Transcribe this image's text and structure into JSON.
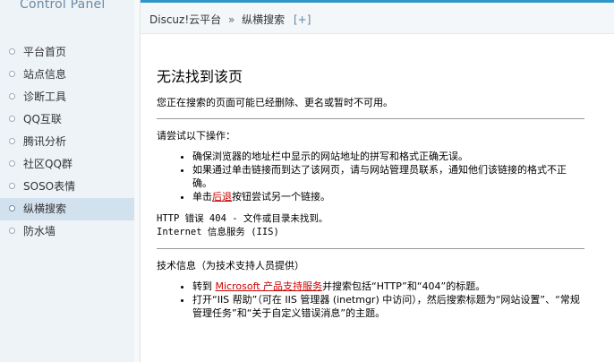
{
  "brand": "Control Panel",
  "nav": [
    {
      "label": "平台首页"
    },
    {
      "label": "站点信息"
    },
    {
      "label": "诊断工具"
    },
    {
      "label": "QQ互联"
    },
    {
      "label": "腾讯分析"
    },
    {
      "label": "社区QQ群"
    },
    {
      "label": "SOSO表情"
    },
    {
      "label": "纵横搜索",
      "active": true
    },
    {
      "label": "防水墙"
    }
  ],
  "breadcrumb": {
    "root": "Discuz!云平台",
    "separator": "»",
    "current": "纵横搜索",
    "add": "[+]"
  },
  "error": {
    "title": "无法找到该页",
    "description": "您正在搜索的页面可能已经删除、更名或暂时不可用。",
    "try_heading": "请尝试以下操作：",
    "tips": [
      "确保浏览器的地址栏中显示的网站地址的拼写和格式正确无误。",
      "如果通过单击链接而到达了该网页，请与网站管理员联系，通知他们该链接的格式不正确。"
    ],
    "tip_back_prefix": "单击",
    "tip_back_link": "后退",
    "tip_back_suffix": "按钮尝试另一个链接。",
    "http_line": "HTTP 错误 404 - 文件或目录未找到。",
    "iis_line": "Internet 信息服务 (IIS)",
    "tech_heading": "技术信息（为技术支持人员提供）",
    "tech_goto_prefix": "转到 ",
    "tech_goto_link": "Microsoft 产品支持服务",
    "tech_goto_suffix": "并搜索包括“HTTP”和“404”的标题。",
    "tech_help": "打开“IIS 帮助”（可在 IIS 管理器 (inetmgr) 中访问），然后搜索标题为“网站设置”、“常规管理任务”和“关于自定义错误消息”的主题。"
  },
  "colors": {
    "accent": "#2f94c8",
    "sidebar_bg": "#eef3f7",
    "active_bg": "#d2e1ee",
    "link": "#cc0000"
  }
}
